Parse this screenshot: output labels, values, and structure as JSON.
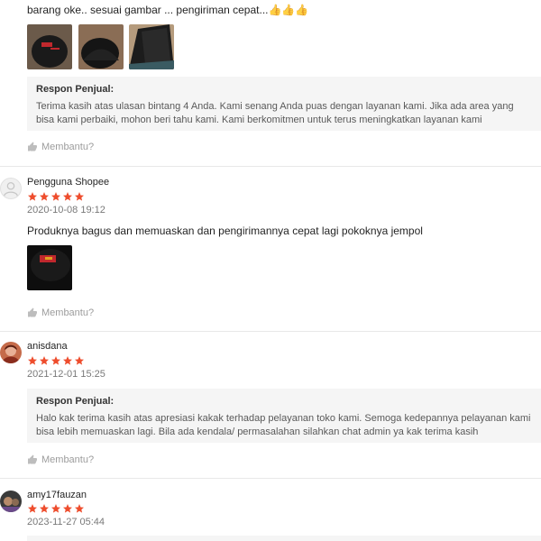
{
  "reviews": [
    {
      "comment": "barang oke.. sesuai gambar ... pengiriman cepat...👍👍👍",
      "seller_response": {
        "title": "Respon Penjual:",
        "body": "Terima kasih atas ulasan bintang 4 Anda. Kami senang Anda puas dengan layanan kami. Jika ada area yang bisa kami perbaiki, mohon beri tahu kami. Kami berkomitmen untuk terus meningkatkan layanan kami"
      },
      "helpful_label": "Membantu?"
    },
    {
      "username": "Pengguna Shopee",
      "rating": 5,
      "date": "2020-10-08 19:12",
      "comment": "Produknya bagus dan memuaskan dan pengirimannya cepat lagi pokoknya jempol",
      "helpful_label": "Membantu?"
    },
    {
      "username": "anisdana",
      "rating": 5,
      "date": "2021-12-01 15:25",
      "seller_response": {
        "title": "Respon Penjual:",
        "body": "Halo kak terima kasih atas apresiasi kakak terhadap pelayanan toko kami. Semoga kedepannya pelayanan kami bisa lebih memuaskan lagi. Bila ada kendala/ permasalahan silahkan chat admin ya kak terima kasih"
      },
      "helpful_label": "Membantu?"
    },
    {
      "username": "amy17fauzan",
      "rating": 5,
      "date": "2023-11-27 05:44"
    }
  ],
  "colors": {
    "star": "#ee4d2d",
    "seller_box": "#f5f5f5"
  }
}
